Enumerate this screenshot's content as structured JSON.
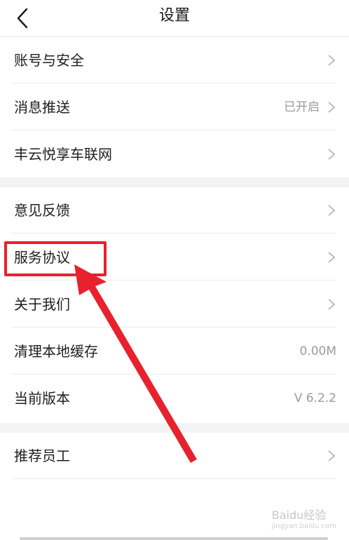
{
  "header": {
    "title": "设置"
  },
  "groups": [
    {
      "items": [
        {
          "label": "账号与安全"
        },
        {
          "label": "消息推送",
          "value": "已开启"
        },
        {
          "label": "丰云悦享车联网"
        }
      ]
    },
    {
      "items": [
        {
          "label": "意见反馈"
        },
        {
          "label": "服务协议"
        },
        {
          "label": "关于我们"
        },
        {
          "label": "清理本地缓存",
          "value": "0.00M"
        },
        {
          "label": "当前版本",
          "value": "V 6.2.2"
        }
      ]
    },
    {
      "items": [
        {
          "label": "推荐员工"
        }
      ]
    }
  ],
  "colors": {
    "highlight": "#e8212e",
    "divider": "#ececec",
    "section_gap": "#f3f3f3"
  },
  "watermark": {
    "text": "Baidu经验",
    "sub": "jingyan.baidu.com"
  }
}
